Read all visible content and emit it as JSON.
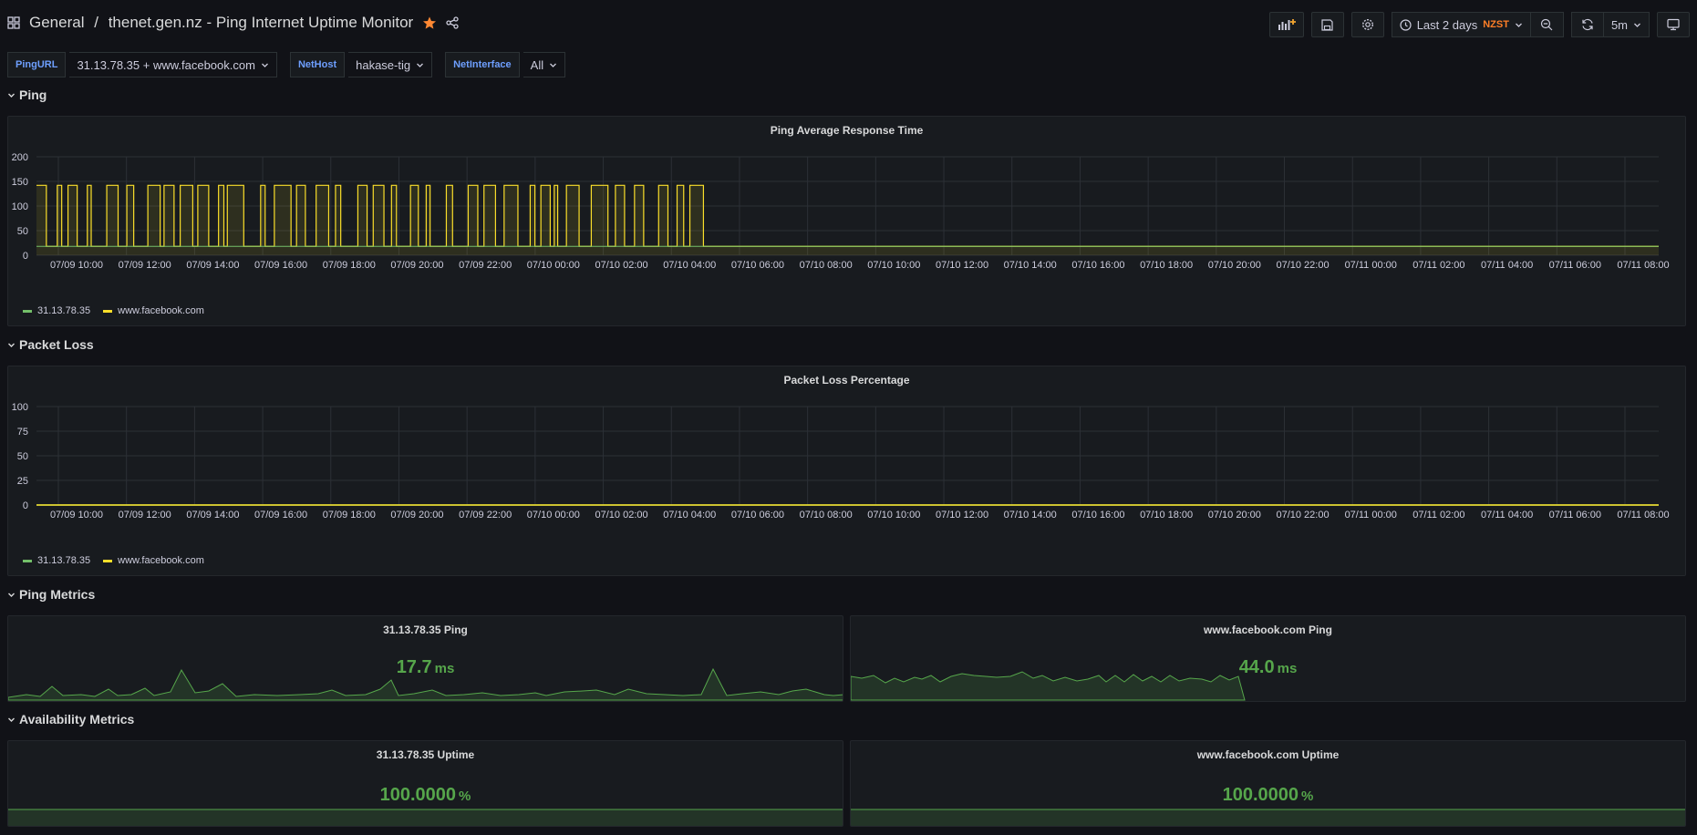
{
  "topbar": {
    "breadcrumb_folder": "General",
    "breadcrumb_sep": "/",
    "dashboard_title": "thenet.gen.nz - Ping Internet Uptime Monitor",
    "time_range": "Last 2 days",
    "timezone": "NZST",
    "refresh_interval": "5m"
  },
  "variables": [
    {
      "label": "PingURL",
      "value": "31.13.78.35 + www.facebook.com"
    },
    {
      "label": "NetHost",
      "value": "hakase-tig"
    },
    {
      "label": "NetInterface",
      "value": "All"
    }
  ],
  "rows": {
    "ping": "Ping",
    "packet_loss": "Packet Loss",
    "ping_metrics": "Ping Metrics",
    "availability": "Availability Metrics"
  },
  "colors": {
    "series_a": "#73bf69",
    "series_b": "#fade2a",
    "stat_green": "#56a64b",
    "timezone": "#ff7f27"
  },
  "ping_graph": {
    "title": "Ping Average Response Time",
    "legend": [
      "31.13.78.35",
      "www.facebook.com"
    ]
  },
  "loss_graph": {
    "title": "Packet Loss Percentage",
    "legend": [
      "31.13.78.35",
      "www.facebook.com"
    ]
  },
  "stats": {
    "ping_a_title": "31.13.78.35 Ping",
    "ping_a_value": "17.7",
    "ping_a_unit": "ms",
    "ping_b_title": "www.facebook.com Ping",
    "ping_b_value": "44.0",
    "ping_b_unit": "ms",
    "uptime_a_title": "31.13.78.35 Uptime",
    "uptime_a_value": "100.0000",
    "uptime_a_unit": "%",
    "uptime_b_title": "www.facebook.com Uptime",
    "uptime_b_value": "100.0000",
    "uptime_b_unit": "%"
  },
  "chart_data": [
    {
      "type": "line",
      "title": "Ping Average Response Time",
      "x": [
        "07/09 10:00",
        "07/09 12:00",
        "07/09 14:00",
        "07/09 16:00",
        "07/09 18:00",
        "07/09 20:00",
        "07/09 22:00",
        "07/10 00:00",
        "07/10 02:00",
        "07/10 04:00",
        "07/10 06:00",
        "07/10 08:00",
        "07/10 10:00",
        "07/10 12:00",
        "07/10 14:00",
        "07/10 16:00",
        "07/10 18:00",
        "07/10 20:00",
        "07/10 22:00",
        "07/11 00:00",
        "07/11 02:00",
        "07/11 04:00",
        "07/11 06:00",
        "07/11 08:00"
      ],
      "yticks": [
        "0",
        "50",
        "100",
        "150",
        "200"
      ],
      "ylim": [
        0,
        200
      ],
      "grid": true,
      "legend_position": "bottom-left",
      "series": [
        {
          "name": "31.13.78.35",
          "values": [
            18,
            18,
            18,
            18,
            18,
            18,
            18,
            18,
            18,
            18,
            18,
            18,
            18,
            18,
            18,
            18,
            18,
            18,
            18,
            18,
            18,
            18,
            18,
            18
          ]
        },
        {
          "name": "www.facebook.com",
          "values": [
            142,
            18,
            142,
            18,
            142,
            18,
            142,
            18,
            142,
            18,
            18,
            18,
            18,
            18,
            18,
            18,
            18,
            18,
            18,
            18,
            18,
            18,
            18,
            18
          ]
        }
      ]
    },
    {
      "type": "line",
      "title": "Packet Loss Percentage",
      "x": [
        "07/09 10:00",
        "07/09 12:00",
        "07/09 14:00",
        "07/09 16:00",
        "07/09 18:00",
        "07/09 20:00",
        "07/09 22:00",
        "07/10 00:00",
        "07/10 02:00",
        "07/10 04:00",
        "07/10 06:00",
        "07/10 08:00",
        "07/10 10:00",
        "07/10 12:00",
        "07/10 14:00",
        "07/10 16:00",
        "07/10 18:00",
        "07/10 20:00",
        "07/10 22:00",
        "07/11 00:00",
        "07/11 02:00",
        "07/11 04:00",
        "07/11 06:00",
        "07/11 08:00"
      ],
      "yticks": [
        "0",
        "25",
        "50",
        "75",
        "100"
      ],
      "ylim": [
        0,
        100
      ],
      "grid": true,
      "legend_position": "bottom-left",
      "series": [
        {
          "name": "31.13.78.35",
          "values": [
            0,
            0,
            0,
            0,
            0,
            0,
            0,
            0,
            0,
            0,
            0,
            0,
            0,
            0,
            0,
            0,
            0,
            0,
            0,
            0,
            0,
            0,
            0,
            0
          ]
        },
        {
          "name": "www.facebook.com",
          "values": [
            0,
            0,
            0,
            0,
            0,
            0,
            0,
            0,
            0,
            0,
            0,
            0,
            0,
            0,
            0,
            0,
            0,
            0,
            0,
            0,
            0,
            0,
            0,
            0
          ]
        }
      ]
    }
  ]
}
